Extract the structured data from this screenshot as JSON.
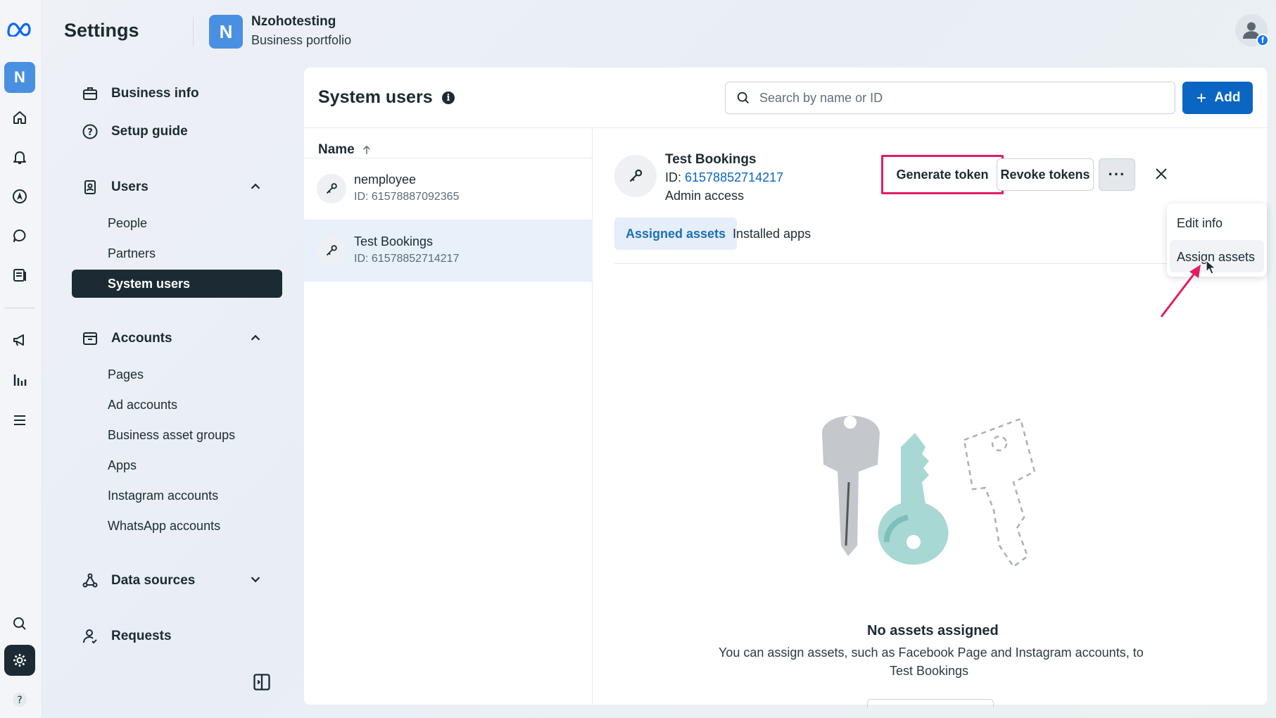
{
  "app": {
    "settings_title": "Settings",
    "business_initial": "N",
    "business_name": "Nzohotesting",
    "business_subtitle": "Business portfolio"
  },
  "rail": {
    "business_initial": "N",
    "icons": [
      "meta-logo-icon",
      "home-icon",
      "bell-icon",
      "navigation-icon",
      "chat-icon",
      "pages-icon",
      "megaphone-icon",
      "insights-icon",
      "menu-icon",
      "search-icon",
      "gear-icon",
      "help-icon"
    ]
  },
  "nav": {
    "business_info": "Business info",
    "setup_guide": "Setup guide",
    "users": {
      "label": "Users",
      "items": [
        "People",
        "Partners",
        "System users"
      ]
    },
    "accounts": {
      "label": "Accounts",
      "items": [
        "Pages",
        "Ad accounts",
        "Business asset groups",
        "Apps",
        "Instagram accounts",
        "WhatsApp accounts"
      ]
    },
    "data_sources": "Data sources",
    "requests": "Requests"
  },
  "panel": {
    "title": "System users",
    "info_glyph": "i",
    "search_placeholder": "Search by name or ID",
    "add_label": "Add",
    "column_header": "Name"
  },
  "system_users": [
    {
      "name": "nemployee",
      "id": "ID: 61578887092365"
    },
    {
      "name": "Test Bookings",
      "id": "ID: 61578852714217"
    }
  ],
  "detail": {
    "name": "Test Bookings",
    "id_prefix": "ID: ",
    "id_value": "61578852714217",
    "access": "Admin access",
    "generate_token": "Generate token",
    "revoke_tokens": "Revoke tokens",
    "more_glyph": "···",
    "tabs": [
      "Assigned assets",
      "Installed apps"
    ],
    "empty_title": "No assets assigned",
    "empty_desc_line1": "You can assign assets, such as Facebook Page and Instagram accounts, to",
    "empty_desc_line2": "Test Bookings"
  },
  "menu": {
    "items": [
      "Edit info",
      "Assign assets"
    ]
  },
  "colors": {
    "primary": "#0a66c2",
    "highlight": "#e11d64",
    "dark": "#1c2b33",
    "brand_avatar": "#4a90e2"
  }
}
